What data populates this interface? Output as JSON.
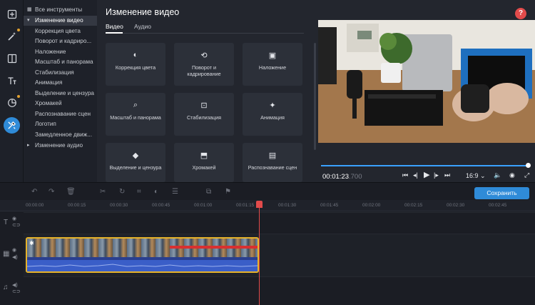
{
  "tree": {
    "items": [
      {
        "label": "Все инструменты",
        "type": "plain"
      },
      {
        "label": "Изменение видео",
        "type": "parent-open"
      },
      {
        "label": "Коррекция цвета"
      },
      {
        "label": "Поворот и кадриро..."
      },
      {
        "label": "Наложение"
      },
      {
        "label": "Масштаб и панорама"
      },
      {
        "label": "Стабилизация"
      },
      {
        "label": "Анимация"
      },
      {
        "label": "Выделение и цензура"
      },
      {
        "label": "Хромакей"
      },
      {
        "label": "Распознавание сцен"
      },
      {
        "label": "Логотип"
      },
      {
        "label": "Замедленное движ..."
      },
      {
        "label": "Изменение аудио",
        "type": "parent-closed"
      }
    ]
  },
  "panel": {
    "title": "Изменение видео",
    "tabs": [
      "Видео",
      "Аудио"
    ],
    "cards": [
      {
        "label": "Коррекция цвета",
        "icon": "color-correction-icon"
      },
      {
        "label": "Поворот и кадрирование",
        "icon": "crop-rotate-icon"
      },
      {
        "label": "Наложение",
        "icon": "overlay-icon"
      },
      {
        "label": "Масштаб и панорама",
        "icon": "zoom-pan-icon"
      },
      {
        "label": "Стабилизация",
        "icon": "stabilization-icon"
      },
      {
        "label": "Анимация",
        "icon": "animation-icon"
      },
      {
        "label": "Выделение и цензура",
        "icon": "highlight-censor-icon"
      },
      {
        "label": "Хромакей",
        "icon": "chroma-key-icon"
      },
      {
        "label": "Распознавание сцен",
        "icon": "scene-detection-icon"
      }
    ]
  },
  "preview": {
    "help": "?",
    "timecode": "00:01:23",
    "timecode_ms": ".700",
    "aspect_ratio": "16:9",
    "progress": 0.99
  },
  "timeline": {
    "save_label": "Сохранить",
    "ruler": [
      "00:00:00",
      "00:00:15",
      "00:00:30",
      "00:00:45",
      "00:01:00",
      "00:01:15",
      "00:01:30",
      "00:01:45",
      "00:02:00",
      "00:02:15",
      "00:02:30",
      "00:02:45"
    ]
  },
  "colors": {
    "accent": "#2f8bd8",
    "playhead": "#e24b4b",
    "clip_border": "#e6b32a",
    "audio": "#3a5ec8"
  }
}
